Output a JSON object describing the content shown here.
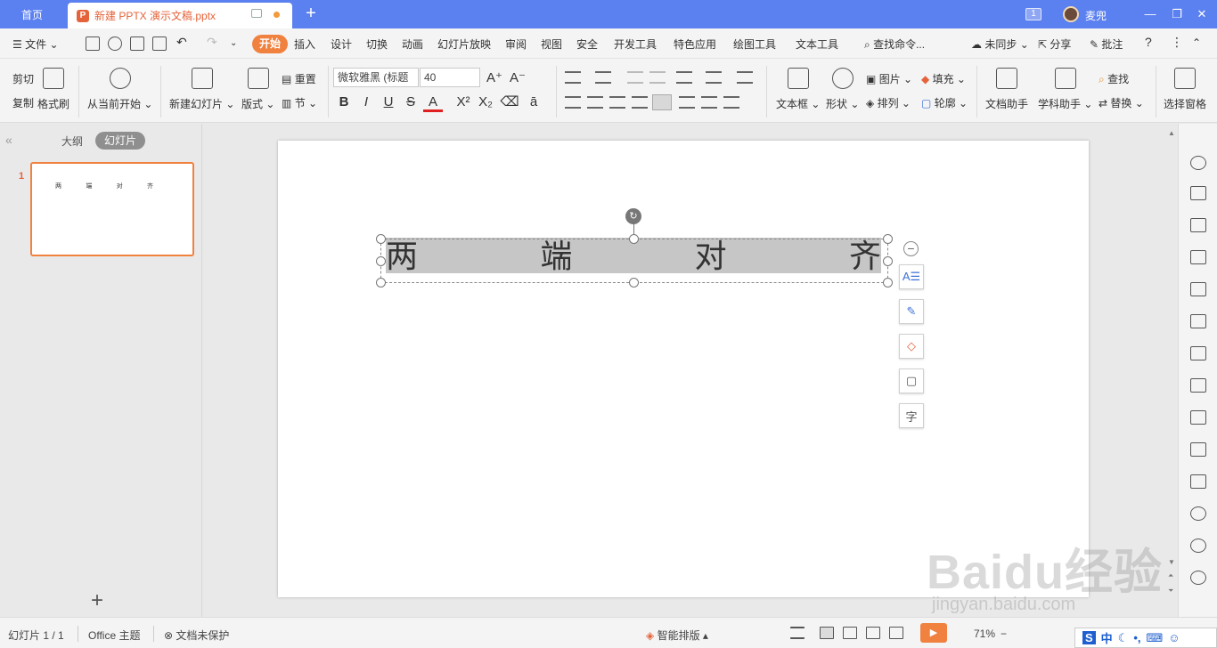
{
  "titlebar": {
    "home_tab": "首页",
    "doc_tab": "新建 PPTX 演示文稿.pptx",
    "window_count": "1",
    "user_name": "麦兜"
  },
  "menu": {
    "file": "文件",
    "items": [
      "开始",
      "插入",
      "设计",
      "切换",
      "动画",
      "幻灯片放映",
      "审阅",
      "视图",
      "安全",
      "开发工具",
      "特色应用",
      "绘图工具",
      "文本工具"
    ],
    "search": "查找命令...",
    "sync": "未同步",
    "share": "分享",
    "comment": "批注"
  },
  "ribbon": {
    "cut": "剪切",
    "copy": "复制",
    "format_painter": "格式刷",
    "from_current": "从当前开始",
    "new_slide": "新建幻灯片",
    "layout": "版式",
    "reset": "重置",
    "section": "节",
    "font_name": "微软雅黑 (标题",
    "font_size": "40",
    "text_box": "文本框",
    "shape": "形状",
    "picture": "图片",
    "arrange": "排列",
    "fill": "填充",
    "outline": "轮廓",
    "doc_assistant": "文档助手",
    "subject_assistant": "学科助手",
    "find": "查找",
    "replace": "替换",
    "select_pane": "选择窗格"
  },
  "left_panel": {
    "tab_outline": "大纲",
    "tab_slides": "幻灯片",
    "slide_number": "1",
    "thumb_chars": [
      "两",
      "端",
      "对",
      "齐"
    ],
    "add_symbol": "+"
  },
  "slide": {
    "title_chars": [
      "两",
      "端",
      "对",
      "齐"
    ]
  },
  "statusbar": {
    "slide_info": "幻灯片 1 / 1",
    "theme": "Office 主题",
    "protection": "文档未保护",
    "smart_layout": "智能排版",
    "zoom": "71%"
  },
  "watermark": {
    "logo": "Baidu经验",
    "url": "jingyan.baidu.com"
  },
  "ime": {
    "mode": "中"
  }
}
